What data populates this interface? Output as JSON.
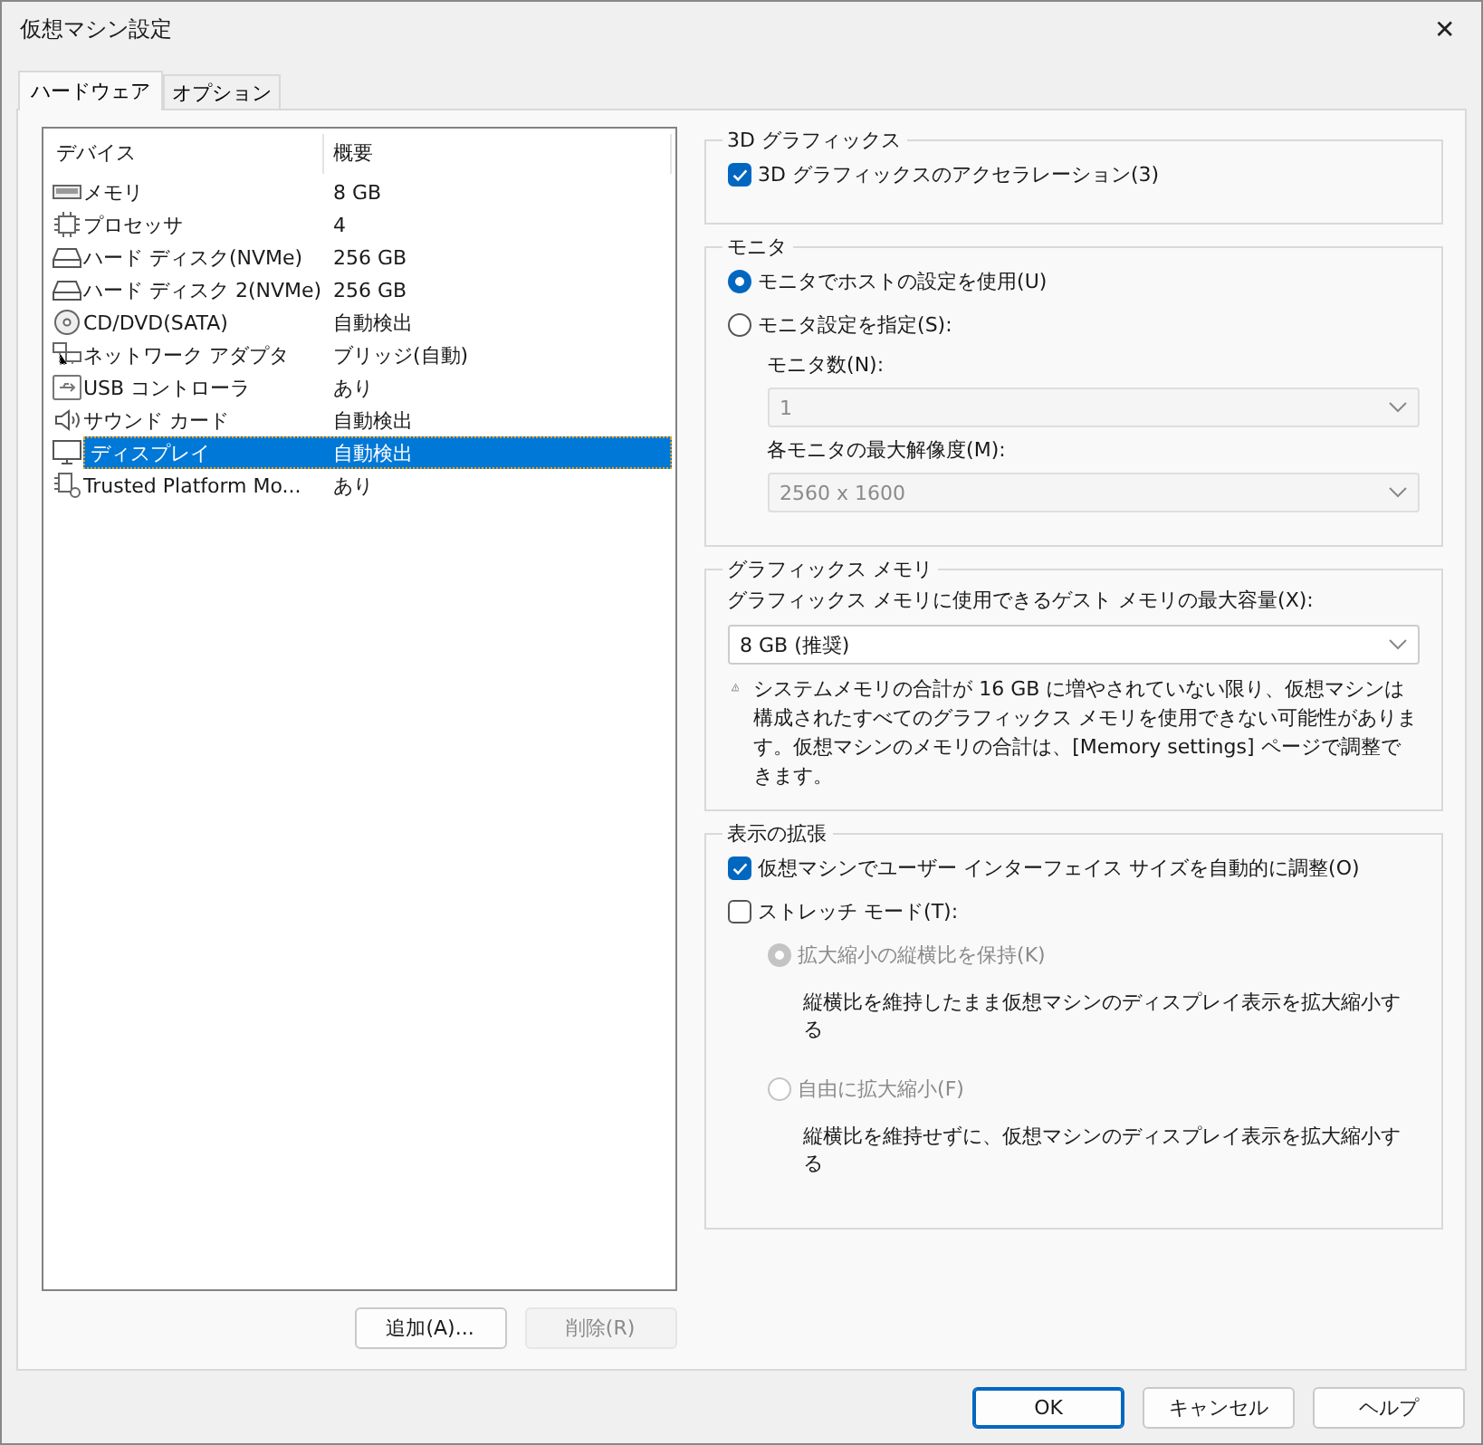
{
  "window": {
    "title": "仮想マシン設定",
    "close": "✕"
  },
  "tabs": [
    {
      "label": "ハードウェア",
      "selected": true
    },
    {
      "label": "オプション",
      "selected": false
    }
  ],
  "devices": {
    "columns": [
      "デバイス",
      "概要"
    ],
    "rows": [
      {
        "kind": "memory",
        "name": "メモリ",
        "summary": "8 GB",
        "selected": false
      },
      {
        "kind": "processor",
        "name": "プロセッサ",
        "summary": "4",
        "selected": false
      },
      {
        "kind": "disk",
        "name": "ハード ディスク(NVMe)",
        "summary": "256 GB",
        "selected": false
      },
      {
        "kind": "disk",
        "name": "ハード ディスク 2(NVMe)",
        "summary": "256 GB",
        "selected": false
      },
      {
        "kind": "cd",
        "name": "CD/DVD(SATA)",
        "summary": "自動検出",
        "selected": false
      },
      {
        "kind": "network",
        "name": "ネットワーク アダプタ",
        "summary": "ブリッジ(自動)",
        "selected": false
      },
      {
        "kind": "usb",
        "name": "USB コントローラ",
        "summary": "あり",
        "selected": false
      },
      {
        "kind": "sound",
        "name": "サウンド カード",
        "summary": "自動検出",
        "selected": false
      },
      {
        "kind": "display",
        "name": "ディスプレイ",
        "summary": "自動検出",
        "selected": true
      },
      {
        "kind": "tpm",
        "name": "Trusted Platform Mo...",
        "summary": "あり",
        "selected": false
      }
    ]
  },
  "device_buttons": [
    {
      "label": "追加(A)...",
      "disabled": false
    },
    {
      "label": "削除(R)",
      "disabled": true
    }
  ],
  "graphics_3d": {
    "title": "3D グラフィックス",
    "acceleration": {
      "label": "3D グラフィックスのアクセラレーション(3)",
      "checked": true
    }
  },
  "monitor": {
    "title": "モニタ",
    "options": [
      {
        "label": "モニタでホストの設定を使用(U)",
        "selected": true
      },
      {
        "label": "モニタ設定を指定(S):",
        "selected": false
      }
    ],
    "fields": [
      {
        "label": "モニタ数(N):",
        "value": "1",
        "disabled": true
      },
      {
        "label": "各モニタの最大解像度(M):",
        "value": "2560 x 1600",
        "disabled": true
      }
    ]
  },
  "graphics_memory": {
    "title": "グラフィックス メモリ",
    "label": "グラフィックス メモリに使用できるゲスト メモリの最大容量(X):",
    "value": "8 GB (推奨)",
    "warning": "システムメモリの合計が 16 GB に増やされていない限り、仮想マシンは構成されたすべてのグラフィックス メモリを使用できない可能性があります。仮想マシンのメモリの合計は、[Memory settings] ページで調整できます。"
  },
  "display_scaling": {
    "title": "表示の拡張",
    "checkboxes": [
      {
        "label": "仮想マシンでユーザー インターフェイス サイズを自動的に調整(O)",
        "checked": true
      },
      {
        "label": "ストレッチ モード(T):",
        "checked": false
      }
    ],
    "stretch_options": [
      {
        "label": "拡大縮小の縦横比を保持(K)",
        "selected": true,
        "disabled": true,
        "description": "縦横比を維持したまま仮想マシンのディスプレイ表示を拡大縮小する"
      },
      {
        "label": "自由に拡大縮小(F)",
        "selected": false,
        "disabled": true,
        "description": "縦横比を維持せずに、仮想マシンのディスプレイ表示を拡大縮小する"
      }
    ]
  },
  "footer_buttons": [
    {
      "label": "OK",
      "kind": "default"
    },
    {
      "label": "キャンセル",
      "kind": "normal"
    },
    {
      "label": "ヘルプ",
      "kind": "normal"
    }
  ]
}
